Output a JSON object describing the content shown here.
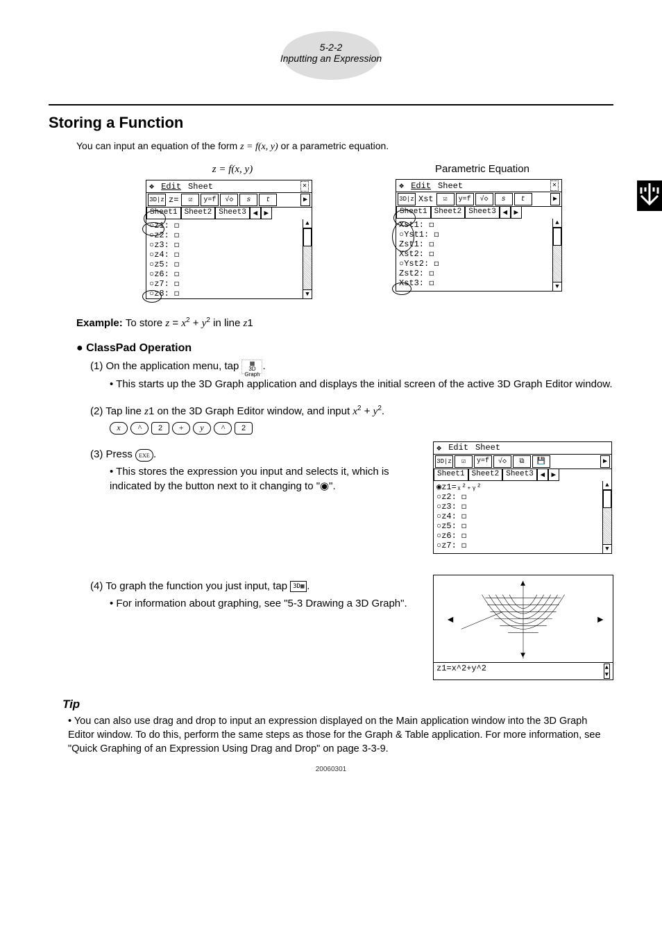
{
  "header": {
    "section_no": "5-2-2",
    "section_title": "Inputting an Expression"
  },
  "title": "Storing a Function",
  "intro": {
    "pre": "You can input an equation of the form ",
    "eq": "z = f(x, y)",
    "post": " or a parametric equation."
  },
  "eq_labels": {
    "left": "z = f(x, y)",
    "right": "Parametric Equation"
  },
  "scr1": {
    "menus": [
      "Edit",
      "Sheet"
    ],
    "menu_dropdown": "❖",
    "close": "✕",
    "mode": "z=",
    "toolbar": [
      "☑",
      "y=f",
      "√◇",
      "s",
      "t"
    ],
    "arrow": "▶",
    "tabs": [
      "Sheet1",
      "Sheet2",
      "Sheet3"
    ],
    "tab_left": "◀",
    "tab_right": "▶",
    "rows": [
      "○z1: ◻",
      "○z2: ◻",
      "○z3: ◻",
      "○z4: ◻",
      "○z5: ◻",
      "○z6: ◻",
      "○z7: ◻",
      "○z8: ◻"
    ]
  },
  "scr2": {
    "menus": [
      "Edit",
      "Sheet"
    ],
    "close": "✕",
    "mode": "Xst",
    "toolbar": [
      "☑",
      "y=f",
      "√◇",
      "s",
      "t"
    ],
    "arrow": "▶",
    "tabs": [
      "Sheet1",
      "Sheet2",
      "Sheet3"
    ],
    "tab_left": "◀",
    "tab_right": "▶",
    "rows": [
      "Xst1: ◻",
      "○Yst1: ◻",
      " Zst1: ◻",
      " Xst2: ◻",
      "○Yst2: ◻",
      " Zst2: ◻",
      " Xst3: ◻"
    ]
  },
  "example": {
    "label": "Example:",
    "text_pre": "To store ",
    "eq": "z = x² + y²",
    "text_post": " in line z1"
  },
  "operation_head": "ClassPad Operation",
  "step1": {
    "text_pre": "(1) On the application menu, tap ",
    "text_post": ".",
    "icon_label": "3D Graph",
    "note": "This starts up the 3D Graph application and displays the initial screen of the active 3D Graph Editor window."
  },
  "step2": {
    "text_pre": "(2) Tap line z1 on the 3D Graph Editor window, and input ",
    "eq": "x² + y²",
    "text_post": ".",
    "keys": [
      "x",
      "^",
      "2",
      "+",
      "y",
      "^",
      "2"
    ]
  },
  "step3": {
    "text": "(3) Press ",
    "key": "EXE",
    "text_post": ".",
    "note": "This stores the expression you input and selects it, which is indicated by the button next to it changing to \"◉\"."
  },
  "scr3": {
    "menus": [
      "Edit",
      "Sheet"
    ],
    "toolbar": [
      "☑",
      "y=f",
      "√◇",
      "⧉",
      "💾"
    ],
    "arrow": "▶",
    "tabs": [
      "Sheet1",
      "Sheet2",
      "Sheet3"
    ],
    "tab_left": "◀",
    "tab_right": "▶",
    "rows": [
      "◉z1=ₓ²₊ᵧ²",
      "○z2: ◻",
      "○z3: ◻",
      "○z4: ◻",
      "○z5: ◻",
      "○z6: ◻",
      "○z7: ◻"
    ]
  },
  "step4": {
    "text_pre": "(4) To graph the function you just input, tap ",
    "text_post": ".",
    "note": "For information about graphing, see \"5-3 Drawing a 3D Graph\"."
  },
  "graph": {
    "status": "z1=x^2+y^2"
  },
  "tip": {
    "head": "Tip",
    "body": "You can also use drag and drop to input an expression displayed on the Main application window into the 3D Graph Editor window. To do this, perform the same steps as those for the Graph & Table application. For more information, see \"Quick Graphing of an Expression Using Drag and Drop\" on page 3-3-9."
  },
  "footer_date": "20060301"
}
